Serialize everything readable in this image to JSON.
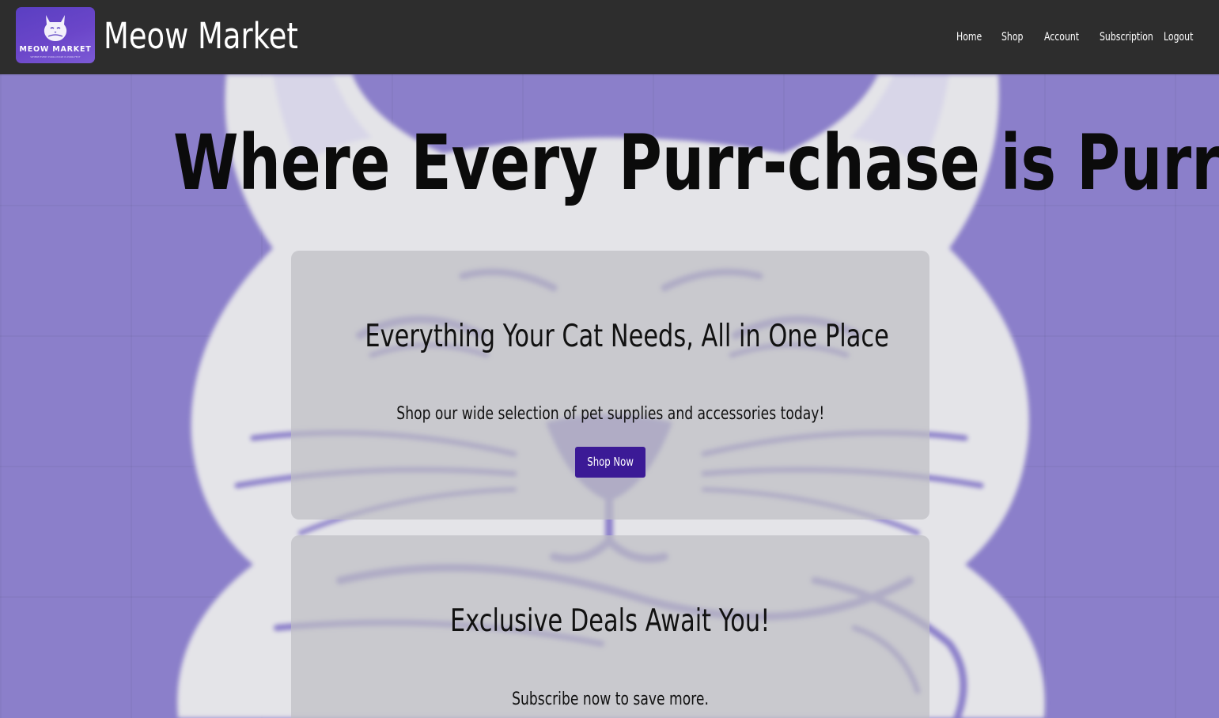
{
  "brand": {
    "logo_text": "MEOW MARKET",
    "logo_tagline": "WHERE EVERY PURR-CHASE IS PURR-FECT",
    "site_title": "Meow Market",
    "accent_color": "#3b1a96",
    "background_color": "#8b7fca",
    "navbar_color": "#2d2d2d"
  },
  "nav": {
    "items": [
      {
        "label": "Home"
      },
      {
        "label": "Shop"
      },
      {
        "label": "Account"
      },
      {
        "label": "Subscription"
      },
      {
        "label": "Logout"
      }
    ]
  },
  "hero": {
    "headline": "Where Every Purr-chase is Purr-fect!",
    "background_icon": "cat-face-icon"
  },
  "cards": [
    {
      "title": "Everything Your Cat Needs, All in One Place",
      "text": "Shop our wide selection of pet supplies and accessories today!",
      "button_label": "Shop Now"
    },
    {
      "title": "Exclusive Deals Await You!",
      "text": "Subscribe now to save more."
    }
  ]
}
